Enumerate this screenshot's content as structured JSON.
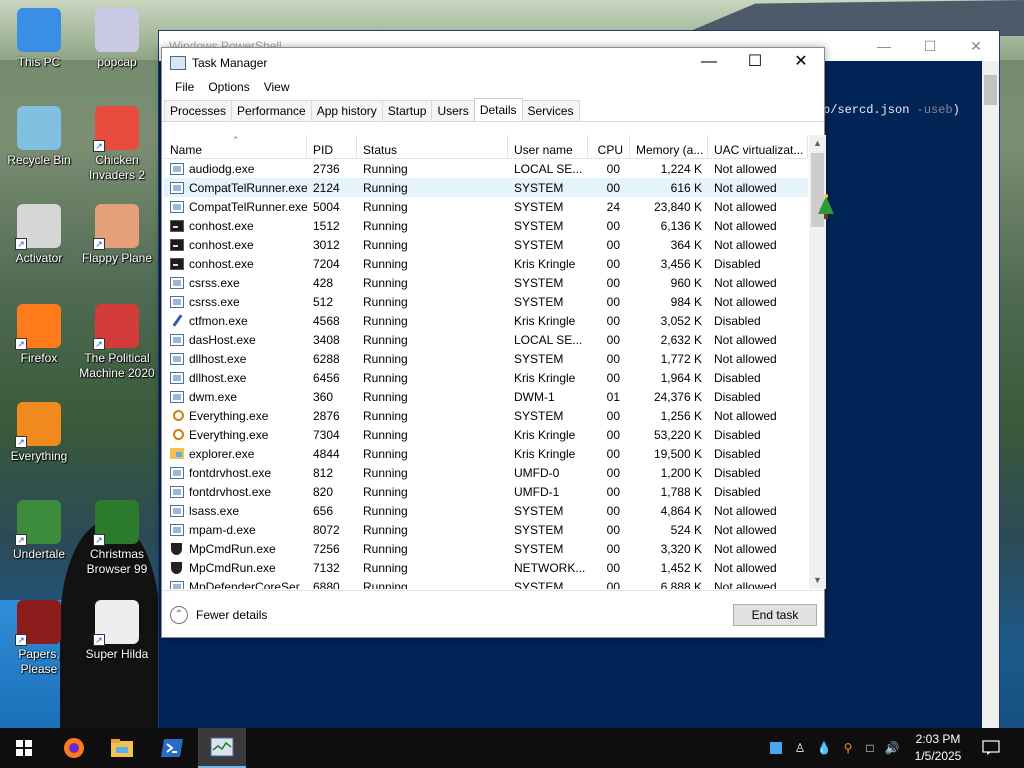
{
  "desktop": {
    "icons": [
      {
        "label": "This PC",
        "name": "this-pc-icon",
        "color": "#3a8ee6"
      },
      {
        "label": "popcap",
        "name": "popcap-icon",
        "color": "#c9c9e6"
      },
      {
        "label": "Recycle Bin",
        "name": "recycle-bin-icon",
        "color": "#7fbfdf"
      },
      {
        "label": "Chicken Invaders 2",
        "name": "chicken-invaders-icon",
        "color": "#e84c3d"
      },
      {
        "label": "Activator",
        "name": "activator-icon",
        "color": "#d6d6d6"
      },
      {
        "label": "Flappy Plane",
        "name": "flappy-plane-icon",
        "color": "#e5a07a"
      },
      {
        "label": "Firefox",
        "name": "firefox-icon",
        "color": "#ff7a1a"
      },
      {
        "label": "The Political Machine 2020",
        "name": "political-machine-icon",
        "color": "#d43c3c"
      },
      {
        "label": "Everything",
        "name": "everything-icon",
        "color": "#f08a1e"
      },
      {
        "label": "Undertale",
        "name": "undertale-icon",
        "color": "#3c8c3c"
      },
      {
        "label": "Christmas Browser 99",
        "name": "christmas-browser-icon",
        "color": "#2c7a2c"
      },
      {
        "label": "Papers, Please",
        "name": "papers-please-icon",
        "color": "#8c1c1c"
      },
      {
        "label": "Super Hilda",
        "name": "super-hilda-icon",
        "color": "#eeeeee"
      }
    ],
    "overlay_badges": {
      "chicken": "2",
      "political": "2020",
      "christmas": "99"
    }
  },
  "powershell": {
    "title": "Windows PowerShell",
    "line_text": "p/sercd.json ",
    "line_param": "-useb",
    "line_tail": ")"
  },
  "task_manager": {
    "title": "Task Manager",
    "menu": [
      "File",
      "Options",
      "View"
    ],
    "tabs": [
      "Processes",
      "Performance",
      "App history",
      "Startup",
      "Users",
      "Details",
      "Services"
    ],
    "active_tab": "Details",
    "columns": [
      "Name",
      "PID",
      "Status",
      "User name",
      "CPU",
      "Memory (a...",
      "UAC virtualizat..."
    ],
    "rows": [
      {
        "name": "audiodg.exe",
        "pid": "2736",
        "status": "Running",
        "user": "LOCAL SE...",
        "cpu": "00",
        "mem": "1,224 K",
        "uac": "Not allowed",
        "icon": "window"
      },
      {
        "name": "CompatTelRunner.exe",
        "pid": "2124",
        "status": "Running",
        "user": "SYSTEM",
        "cpu": "00",
        "mem": "616 K",
        "uac": "Not allowed",
        "icon": "window",
        "selected": true
      },
      {
        "name": "CompatTelRunner.exe",
        "pid": "5004",
        "status": "Running",
        "user": "SYSTEM",
        "cpu": "24",
        "mem": "23,840 K",
        "uac": "Not allowed",
        "icon": "window"
      },
      {
        "name": "conhost.exe",
        "pid": "1512",
        "status": "Running",
        "user": "SYSTEM",
        "cpu": "00",
        "mem": "6,136 K",
        "uac": "Not allowed",
        "icon": "console"
      },
      {
        "name": "conhost.exe",
        "pid": "3012",
        "status": "Running",
        "user": "SYSTEM",
        "cpu": "00",
        "mem": "364 K",
        "uac": "Not allowed",
        "icon": "console"
      },
      {
        "name": "conhost.exe",
        "pid": "7204",
        "status": "Running",
        "user": "Kris Kringle",
        "cpu": "00",
        "mem": "3,456 K",
        "uac": "Disabled",
        "icon": "console"
      },
      {
        "name": "csrss.exe",
        "pid": "428",
        "status": "Running",
        "user": "SYSTEM",
        "cpu": "00",
        "mem": "960 K",
        "uac": "Not allowed",
        "icon": "window"
      },
      {
        "name": "csrss.exe",
        "pid": "512",
        "status": "Running",
        "user": "SYSTEM",
        "cpu": "00",
        "mem": "984 K",
        "uac": "Not allowed",
        "icon": "window"
      },
      {
        "name": "ctfmon.exe",
        "pid": "4568",
        "status": "Running",
        "user": "Kris Kringle",
        "cpu": "00",
        "mem": "3,052 K",
        "uac": "Disabled",
        "icon": "pen"
      },
      {
        "name": "dasHost.exe",
        "pid": "3408",
        "status": "Running",
        "user": "LOCAL SE...",
        "cpu": "00",
        "mem": "2,632 K",
        "uac": "Not allowed",
        "icon": "window"
      },
      {
        "name": "dllhost.exe",
        "pid": "6288",
        "status": "Running",
        "user": "SYSTEM",
        "cpu": "00",
        "mem": "1,772 K",
        "uac": "Not allowed",
        "icon": "window"
      },
      {
        "name": "dllhost.exe",
        "pid": "6456",
        "status": "Running",
        "user": "Kris Kringle",
        "cpu": "00",
        "mem": "1,964 K",
        "uac": "Disabled",
        "icon": "window"
      },
      {
        "name": "dwm.exe",
        "pid": "360",
        "status": "Running",
        "user": "DWM-1",
        "cpu": "01",
        "mem": "24,376 K",
        "uac": "Disabled",
        "icon": "window"
      },
      {
        "name": "Everything.exe",
        "pid": "2876",
        "status": "Running",
        "user": "SYSTEM",
        "cpu": "00",
        "mem": "1,256 K",
        "uac": "Not allowed",
        "icon": "search"
      },
      {
        "name": "Everything.exe",
        "pid": "7304",
        "status": "Running",
        "user": "Kris Kringle",
        "cpu": "00",
        "mem": "53,220 K",
        "uac": "Disabled",
        "icon": "search"
      },
      {
        "name": "explorer.exe",
        "pid": "4844",
        "status": "Running",
        "user": "Kris Kringle",
        "cpu": "00",
        "mem": "19,500 K",
        "uac": "Disabled",
        "icon": "folder"
      },
      {
        "name": "fontdrvhost.exe",
        "pid": "812",
        "status": "Running",
        "user": "UMFD-0",
        "cpu": "00",
        "mem": "1,200 K",
        "uac": "Disabled",
        "icon": "window"
      },
      {
        "name": "fontdrvhost.exe",
        "pid": "820",
        "status": "Running",
        "user": "UMFD-1",
        "cpu": "00",
        "mem": "1,788 K",
        "uac": "Disabled",
        "icon": "window"
      },
      {
        "name": "lsass.exe",
        "pid": "656",
        "status": "Running",
        "user": "SYSTEM",
        "cpu": "00",
        "mem": "4,864 K",
        "uac": "Not allowed",
        "icon": "window"
      },
      {
        "name": "mpam-d.exe",
        "pid": "8072",
        "status": "Running",
        "user": "SYSTEM",
        "cpu": "00",
        "mem": "524 K",
        "uac": "Not allowed",
        "icon": "window"
      },
      {
        "name": "MpCmdRun.exe",
        "pid": "7256",
        "status": "Running",
        "user": "SYSTEM",
        "cpu": "00",
        "mem": "3,320 K",
        "uac": "Not allowed",
        "icon": "shield"
      },
      {
        "name": "MpCmdRun.exe",
        "pid": "7132",
        "status": "Running",
        "user": "NETWORK...",
        "cpu": "00",
        "mem": "1,452 K",
        "uac": "Not allowed",
        "icon": "shield"
      },
      {
        "name": "MpDefenderCoreSer...",
        "pid": "6880",
        "status": "Running",
        "user": "SYSTEM",
        "cpu": "00",
        "mem": "6,888 K",
        "uac": "Not allowed",
        "icon": "window"
      }
    ],
    "fewer_details": "Fewer details",
    "end_task": "End task"
  },
  "taskbar": {
    "time": "2:03 PM",
    "date": "1/5/2025",
    "accent": "#76b9ed"
  }
}
